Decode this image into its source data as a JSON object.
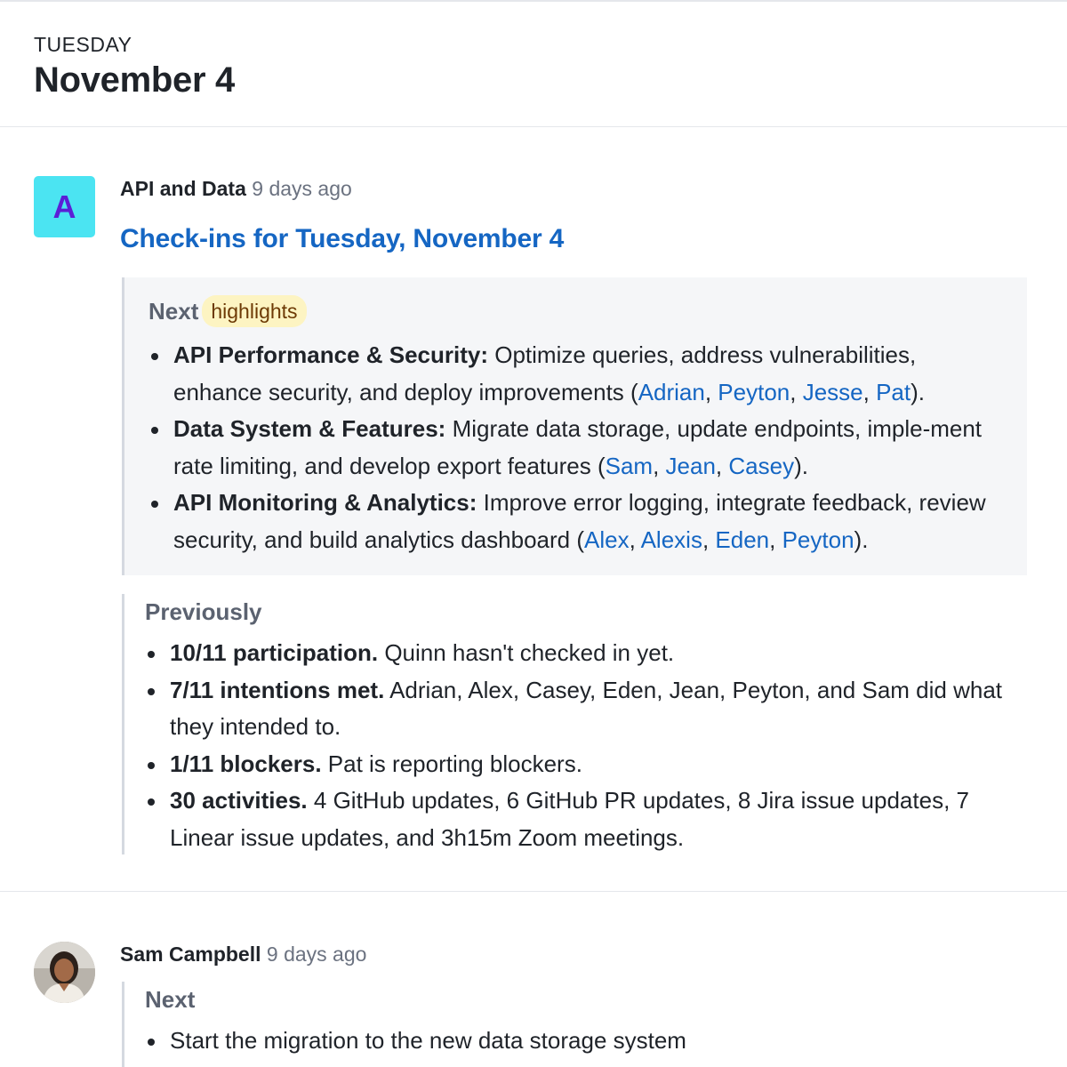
{
  "day": {
    "weekday": "TUESDAY",
    "date": "November 4"
  },
  "post1": {
    "avatar_letter": "A",
    "author": "API and Data",
    "time": "9 days ago",
    "title": "Check-ins for Tuesday, November 4",
    "next": {
      "label": "Next",
      "pill": "highlights",
      "items": [
        {
          "heading": "API Performance & Security:",
          "text": " Optimize queries, address vulnerabilities, enhance security, and deploy improvements (",
          "people": [
            "Adrian",
            "Peyton",
            "Jesse",
            "Pat"
          ],
          "end": ")."
        },
        {
          "heading": "Data System & Features:",
          "text": " Migrate data storage, update endpoints, imple-ment rate limiting, and develop export features (",
          "people": [
            "Sam",
            "Jean",
            "Casey"
          ],
          "end": ")."
        },
        {
          "heading": "API Monitoring & Analytics:",
          "text": " Improve error logging, integrate feedback, review security, and build analytics dashboard (",
          "people": [
            "Alex",
            "Alexis",
            "Eden",
            "Peyton"
          ],
          "end": ")."
        }
      ]
    },
    "previously": {
      "label": "Previously",
      "items": [
        {
          "heading": "10/11 participation.",
          "text": " Quinn hasn't checked in yet."
        },
        {
          "heading": "7/11 intentions met.",
          "text": " Adrian, Alex, Casey, Eden, Jean, Peyton, and Sam did what they intended to."
        },
        {
          "heading": "1/11 blockers.",
          "text": " Pat is reporting blockers."
        },
        {
          "heading": "30 activities.",
          "text": " 4 GitHub updates, 6 GitHub PR updates, 8 Jira issue updates, 7 Linear issue updates, and 3h15m Zoom meetings."
        }
      ]
    }
  },
  "post2": {
    "author": "Sam Campbell",
    "time": "9 days ago",
    "next_label": "Next",
    "items": [
      "Start the migration to the new data storage system"
    ]
  },
  "colors": {
    "link": "#1566c3",
    "avatar_bg": "#4be4f2",
    "avatar_fg": "#5b1fd6",
    "pill_bg": "#fdf4c2"
  }
}
